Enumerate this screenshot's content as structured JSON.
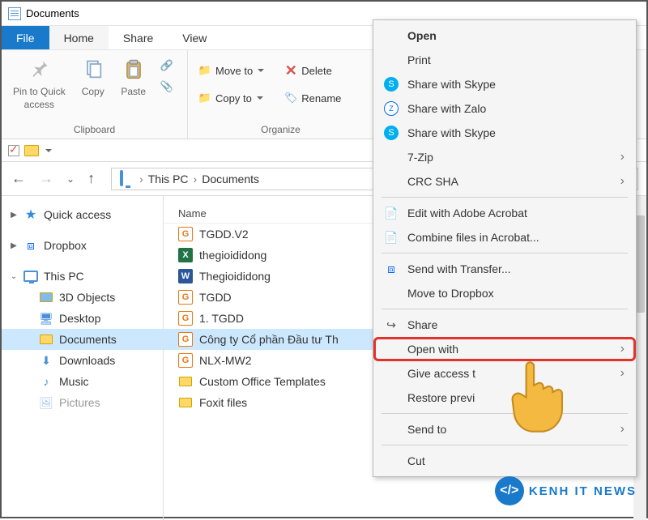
{
  "window": {
    "title": "Documents"
  },
  "tabs": {
    "file": "File",
    "home": "Home",
    "share": "Share",
    "view": "View"
  },
  "ribbon": {
    "pin": "Pin to Quick\naccess",
    "copy": "Copy",
    "paste": "Paste",
    "clipboard_label": "Clipboard",
    "move_to": "Move to",
    "copy_to": "Copy to",
    "delete": "Delete",
    "rename": "Rename",
    "organize_label": "Organize"
  },
  "breadcrumb": {
    "root": "This PC",
    "folder": "Documents"
  },
  "sidebar": {
    "quick_access": "Quick access",
    "dropbox": "Dropbox",
    "this_pc": "This PC",
    "items": {
      "0": "3D Objects",
      "1": "Desktop",
      "2": "Documents",
      "3": "Downloads",
      "4": "Music",
      "5": "Pictures"
    }
  },
  "filelist": {
    "header_name": "Name",
    "rows": {
      "0": "TGDD.V2",
      "1": "thegioididong",
      "2": "Thegioididong",
      "3": "TGDD",
      "4": "1. TGDD",
      "5": "Công ty Cổ phần Đầu tư Th",
      "6": "NLX-MW2",
      "7": "Custom Office Templates",
      "8": "Foxit files"
    }
  },
  "context_menu": {
    "open": "Open",
    "print": "Print",
    "share_skype": "Share with Skype",
    "share_zalo": "Share with Zalo",
    "share_skype2": "Share with Skype",
    "seven_zip": "7-Zip",
    "crc_sha": "CRC SHA",
    "edit_acrobat": "Edit with Adobe Acrobat",
    "combine_acrobat": "Combine files in Acrobat...",
    "send_transfer": "Send with Transfer...",
    "move_dropbox": "Move to Dropbox",
    "share": "Share",
    "open_with": "Open with",
    "give_access": "Give access t",
    "restore": "Restore previ",
    "send_to": "Send to",
    "cut": "Cut"
  },
  "watermark": {
    "text": "KENH IT NEWS",
    "logo": "</>"
  }
}
